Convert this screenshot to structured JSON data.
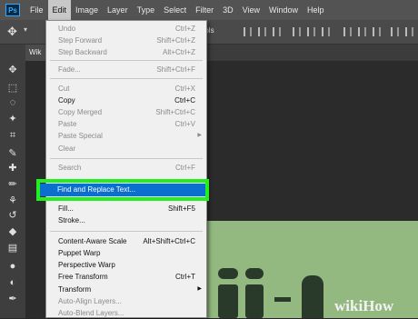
{
  "menubar": {
    "logo": "Ps",
    "items": [
      "File",
      "Edit",
      "Image",
      "Layer",
      "Type",
      "Select",
      "Filter",
      "3D",
      "View",
      "Window",
      "Help"
    ]
  },
  "optionsbar": {
    "controls_text": "ntrols"
  },
  "document_tab": {
    "label": "Wik"
  },
  "edit_menu": {
    "items": [
      {
        "label": "Undo",
        "shortcut": "Ctrl+Z",
        "enabled": false
      },
      {
        "label": "Step Forward",
        "shortcut": "Shift+Ctrl+Z",
        "enabled": false
      },
      {
        "label": "Step Backward",
        "shortcut": "Alt+Ctrl+Z",
        "enabled": false
      },
      {
        "label": "Fade...",
        "shortcut": "Shift+Ctrl+F",
        "enabled": false
      },
      {
        "label": "Cut",
        "shortcut": "Ctrl+X",
        "enabled": false
      },
      {
        "label": "Copy",
        "shortcut": "Ctrl+C",
        "enabled": true
      },
      {
        "label": "Copy Merged",
        "shortcut": "Shift+Ctrl+C",
        "enabled": false
      },
      {
        "label": "Paste",
        "shortcut": "Ctrl+V",
        "enabled": false
      },
      {
        "label": "Paste Special",
        "shortcut": "",
        "enabled": false,
        "submenu": true
      },
      {
        "label": "Clear",
        "shortcut": "",
        "enabled": false
      },
      {
        "label": "Search",
        "shortcut": "Ctrl+F",
        "enabled": false
      },
      {
        "label": "Fill...",
        "shortcut": "Shift+F5",
        "enabled": true
      },
      {
        "label": "Stroke...",
        "shortcut": "",
        "enabled": true
      },
      {
        "label": "Content-Aware Scale",
        "shortcut": "Alt+Shift+Ctrl+C",
        "enabled": true
      },
      {
        "label": "Puppet Warp",
        "shortcut": "",
        "enabled": true
      },
      {
        "label": "Perspective Warp",
        "shortcut": "",
        "enabled": true
      },
      {
        "label": "Free Transform",
        "shortcut": "Ctrl+T",
        "enabled": true
      },
      {
        "label": "Transform",
        "shortcut": "",
        "enabled": true,
        "submenu": true
      },
      {
        "label": "Auto-Align Layers...",
        "shortcut": "",
        "enabled": false
      },
      {
        "label": "Auto-Blend Layers...",
        "shortcut": "",
        "enabled": false
      }
    ],
    "highlighted": "Find and Replace Text...",
    "submenu_arrow": "▶",
    "highlight_color": "#22ee22",
    "selection_color": "#0b6fcf"
  },
  "toolbar": {
    "tools": [
      "move-icon",
      "marquee-icon",
      "lasso-icon",
      "magic-wand-icon",
      "crop-icon",
      "eyedropper-icon",
      "healing-icon",
      "brush-icon",
      "clone-stamp-icon",
      "history-brush-icon",
      "eraser-icon",
      "gradient-icon",
      "blur-icon",
      "dodge-icon",
      "pen-icon"
    ],
    "glyphs": [
      "✥",
      "⬚",
      "◌",
      "✦",
      "⌗",
      "✎",
      "✚",
      "✏",
      "⚘",
      "↺",
      "◆",
      "▤",
      "●",
      "◐",
      "✒"
    ]
  },
  "watermark": {
    "wiki": "wiki",
    "how": "How"
  },
  "colors": {
    "menubar": "#535353",
    "artboard": "#93b980",
    "canvas": "#2b2b2b"
  }
}
